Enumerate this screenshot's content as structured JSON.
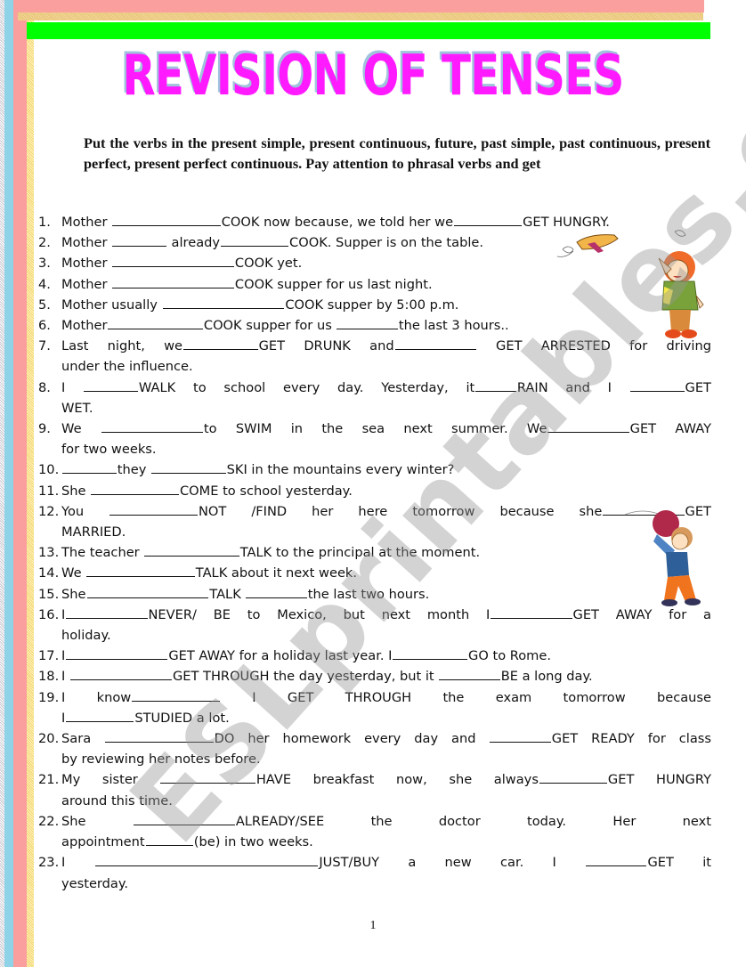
{
  "title": "REVISION OF TENSES",
  "instructions": "Put the verbs in the present simple, present continuous, future, past simple, past continuous, present perfect, present perfect continuous.  Pay attention to phrasal verbs and get",
  "exercises": [
    {
      "n": "1.",
      "lines": [
        "Mother ________________COOK now because, we told her we__________GET HUNGRY."
      ]
    },
    {
      "n": "2.",
      "lines": [
        "Mother ________  already__________COOK. Supper is  on the table."
      ]
    },
    {
      "n": "3.",
      "lines": [
        "Mother __________________COOK yet."
      ]
    },
    {
      "n": "4.",
      "lines": [
        "Mother __________________COOK supper for us last night."
      ]
    },
    {
      "n": "5.",
      "lines": [
        "Mother usually __________________COOK supper by 5:00 p.m."
      ]
    },
    {
      "n": "6.",
      "lines": [
        "Mother______________COOK supper for  us _________the last 3 hours.."
      ]
    },
    {
      "n": "7.",
      "lines": [
        "Last night, we___________GET DRUNK and____________ GET ARRESTED for driving",
        "under the influence."
      ]
    },
    {
      "n": "8.",
      "lines": [
        "I ________WALK to school every day.  Yesterday, it______RAIN and I ________GET",
        "WET."
      ]
    },
    {
      "n": "9.",
      "lines": [
        "We _______________to SWIM in the sea next summer. We____________GET AWAY",
        "for two weeks."
      ]
    },
    {
      "n": "10.",
      "lines": [
        "________they ___________SKI in the mountains every winter?"
      ]
    },
    {
      "n": "11.",
      "lines": [
        "She _____________COME to school yesterday."
      ]
    },
    {
      "n": "12.",
      "lines": [
        "You _____________NOT /FIND her here tomorrow because she____________GET",
        "MARRIED."
      ]
    },
    {
      "n": "13.",
      "lines": [
        "The teacher ______________TALK  to the principal at the moment."
      ]
    },
    {
      "n": "14.",
      "lines": [
        "We ________________TALK about it next week."
      ]
    },
    {
      "n": "15.",
      "lines": [
        "She__________________TALK _________the last two hours."
      ]
    },
    {
      "n": "16.",
      "lines": [
        "I____________NEVER/ BE to Mexico, but next month I____________GET AWAY for a",
        "holiday."
      ]
    },
    {
      "n": "17.",
      "lines": [
        "I_______________GET AWAY for a holiday last year.  I___________GO to Rome."
      ]
    },
    {
      "n": "18.",
      "lines": [
        "I _______________GET THROUGH the day yesterday, but it _________BE a long day."
      ]
    },
    {
      "n": "19.",
      "lines": [
        "I know_____________ I GET THROUGH the exam tomorrow because",
        "I__________STUDIED a lot."
      ]
    },
    {
      "n": "20.",
      "lines": [
        "Sara ________________DO her homework every day and _________GET READY for class",
        "by reviewing her notes before."
      ]
    },
    {
      "n": "21.",
      "lines": [
        "My sister ______________HAVE breakfast now, she always__________GET HUNGRY",
        "around this time."
      ]
    },
    {
      "n": "22.",
      "lines": [
        "She _______________ALREADY/SEE the doctor today.  Her next",
        "appointment_______(be) in two weeks."
      ]
    },
    {
      "n": "23.",
      "lines": [
        "I _________________________________JUST/BUY a new car.  I _________GET it",
        "yesterday."
      ]
    }
  ],
  "watermark": "ESLprintables.com",
  "page_number": "1",
  "colors": {
    "title": "#ff1aff",
    "title_shadow": "#9fc3dd",
    "green_bar": "#00ff00",
    "pink_border": "#fb9f9e",
    "blue_border": "#8fd3e8"
  }
}
